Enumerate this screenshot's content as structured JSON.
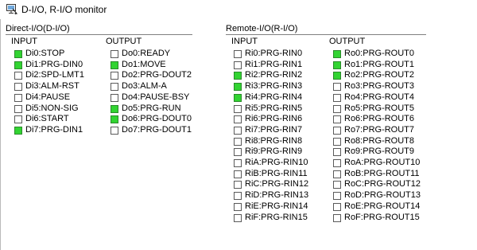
{
  "window": {
    "title": "D-I/O, R-I/O monitor",
    "icon": "monitor-icon"
  },
  "colors": {
    "on": "#32d432",
    "off": "#ffffff"
  },
  "direct": {
    "title": "Direct-I/O(D-I/O)",
    "input_label": "INPUT",
    "output_label": "OUTPUT",
    "inputs": [
      {
        "label": "Di0:STOP",
        "on": true
      },
      {
        "label": "Di1:PRG-DIN0",
        "on": true
      },
      {
        "label": "Di2:SPD-LMT1",
        "on": false
      },
      {
        "label": "Di3:ALM-RST",
        "on": false
      },
      {
        "label": "Di4:PAUSE",
        "on": false
      },
      {
        "label": "Di5:NON-SIG",
        "on": false
      },
      {
        "label": "Di6:START",
        "on": false
      },
      {
        "label": "Di7:PRG-DIN1",
        "on": true
      }
    ],
    "outputs": [
      {
        "label": "Do0:READY",
        "on": false
      },
      {
        "label": "Do1:MOVE",
        "on": true
      },
      {
        "label": "Do2:PRG-DOUT2",
        "on": false
      },
      {
        "label": "Do3:ALM-A",
        "on": false
      },
      {
        "label": "Do4:PAUSE-BSY",
        "on": false
      },
      {
        "label": "Do5:PRG-RUN",
        "on": true
      },
      {
        "label": "Do6:PRG-DOUT0",
        "on": true
      },
      {
        "label": "Do7:PRG-DOUT1",
        "on": false
      }
    ]
  },
  "remote": {
    "title": "Remote-I/O(R-I/O)",
    "input_label": "INPUT",
    "output_label": "OUTPUT",
    "inputs": [
      {
        "label": "Ri0:PRG-RIN0",
        "on": false
      },
      {
        "label": "Ri1:PRG-RIN1",
        "on": false
      },
      {
        "label": "Ri2:PRG-RIN2",
        "on": true
      },
      {
        "label": "Ri3:PRG-RIN3",
        "on": true
      },
      {
        "label": "Ri4:PRG-RIN4",
        "on": true
      },
      {
        "label": "Ri5:PRG-RIN5",
        "on": false
      },
      {
        "label": "Ri6:PRG-RIN6",
        "on": false
      },
      {
        "label": "Ri7:PRG-RIN7",
        "on": false
      },
      {
        "label": "Ri8:PRG-RIN8",
        "on": false
      },
      {
        "label": "Ri9:PRG-RIN9",
        "on": false
      },
      {
        "label": "RiA:PRG-RIN10",
        "on": false
      },
      {
        "label": "RiB:PRG-RIN11",
        "on": false
      },
      {
        "label": "RiC:PRG-RIN12",
        "on": false
      },
      {
        "label": "RiD:PRG-RIN13",
        "on": false
      },
      {
        "label": "RiE:PRG-RIN14",
        "on": false
      },
      {
        "label": "RiF:PRG-RIN15",
        "on": false
      }
    ],
    "outputs": [
      {
        "label": "Ro0:PRG-ROUT0",
        "on": true
      },
      {
        "label": "Ro1:PRG-ROUT1",
        "on": true
      },
      {
        "label": "Ro2:PRG-ROUT2",
        "on": true
      },
      {
        "label": "Ro3:PRG-ROUT3",
        "on": false
      },
      {
        "label": "Ro4:PRG-ROUT4",
        "on": false
      },
      {
        "label": "Ro5:PRG-ROUT5",
        "on": false
      },
      {
        "label": "Ro6:PRG-ROUT6",
        "on": false
      },
      {
        "label": "Ro7:PRG-ROUT7",
        "on": false
      },
      {
        "label": "Ro8:PRG-ROUT8",
        "on": false
      },
      {
        "label": "Ro9:PRG-ROUT9",
        "on": false
      },
      {
        "label": "RoA:PRG-ROUT10",
        "on": false
      },
      {
        "label": "RoB:PRG-ROUT11",
        "on": false
      },
      {
        "label": "RoC:PRG-ROUT12",
        "on": false
      },
      {
        "label": "RoD:PRG-ROUT13",
        "on": false
      },
      {
        "label": "RoE:PRG-ROUT14",
        "on": false
      },
      {
        "label": "RoF:PRG-ROUT15",
        "on": false
      }
    ]
  }
}
